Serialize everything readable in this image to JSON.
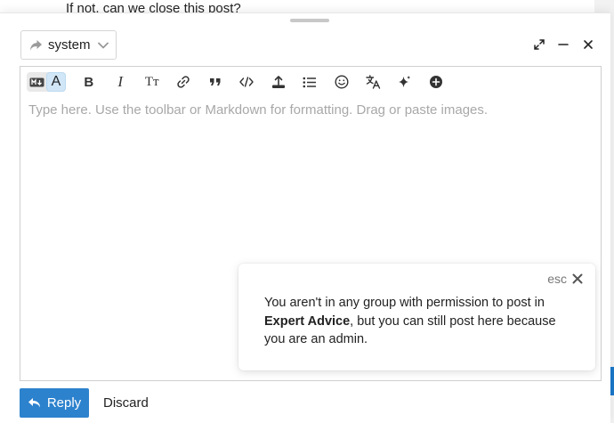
{
  "background": {
    "post_text": "If not, can we close this post?"
  },
  "composer": {
    "reply_to": {
      "label": "system",
      "icon": "share-arrow-icon",
      "dropdown_icon": "chevron-down-icon"
    },
    "window_controls": [
      "expand-icon",
      "minimize-icon",
      "close-icon"
    ],
    "editor": {
      "mode_toggle": {
        "markdown_label": "M↓",
        "rich_text_label": "A"
      },
      "toolbar": {
        "bold": "B",
        "italic": "I",
        "heading": "Tт",
        "link": "link-icon",
        "quote": "quote-icon",
        "code": "code-icon",
        "upload": "upload-icon",
        "list": "list-icon",
        "emoji": "smile-icon",
        "translate": "translate-icon",
        "ai": "sparkle-icon",
        "more": "plus-circle-icon"
      },
      "placeholder": "Type here. Use the toolbar or Markdown for formatting. Drag or paste images."
    },
    "notice": {
      "esc_label": "esc",
      "message_before": "You aren't in any group with permission to post in ",
      "category": "Expert Advice",
      "message_after": ", but you can still post here because you are an admin."
    },
    "actions": {
      "reply_label": "Reply",
      "discard_label": "Discard"
    }
  },
  "colors": {
    "primary": "#2d82cd",
    "rich_text_active": "#d1e7f7"
  }
}
